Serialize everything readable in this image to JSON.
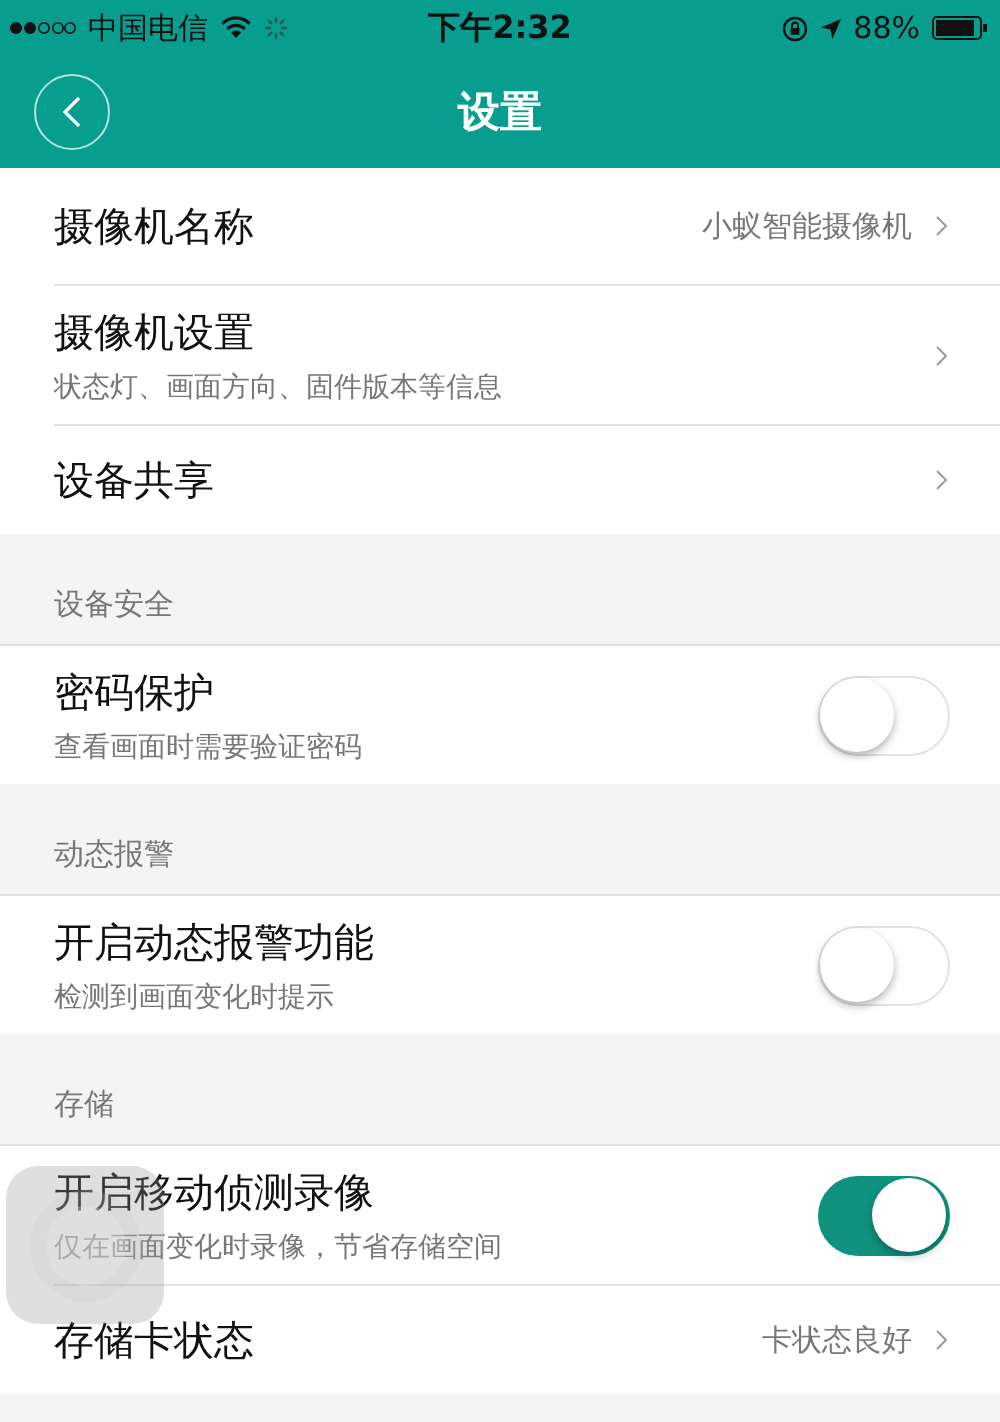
{
  "status_bar": {
    "carrier": "中国电信",
    "time": "下午2:32",
    "battery": "88%"
  },
  "nav": {
    "title": "设置"
  },
  "sections": [
    {
      "items": [
        {
          "kind": "link",
          "label": "摄像机名称",
          "value": "小蚁智能摄像机"
        },
        {
          "kind": "link",
          "label": "摄像机设置",
          "subtitle": "状态灯、画面方向、固件版本等信息"
        },
        {
          "kind": "link",
          "label": "设备共享"
        }
      ]
    },
    {
      "header": "设备安全",
      "items": [
        {
          "kind": "toggle",
          "label": "密码保护",
          "subtitle": "查看画面时需要验证密码",
          "on": false
        }
      ]
    },
    {
      "header": "动态报警",
      "items": [
        {
          "kind": "toggle",
          "label": "开启动态报警功能",
          "subtitle": "检测到画面变化时提示",
          "on": false
        }
      ]
    },
    {
      "header": "存储",
      "items": [
        {
          "kind": "toggle",
          "label": "开启移动侦测录像",
          "subtitle": "仅在画面变化时录像，节省存储空间",
          "on": true
        },
        {
          "kind": "link",
          "label": "存储卡状态",
          "value": "卡状态良好"
        }
      ]
    }
  ]
}
